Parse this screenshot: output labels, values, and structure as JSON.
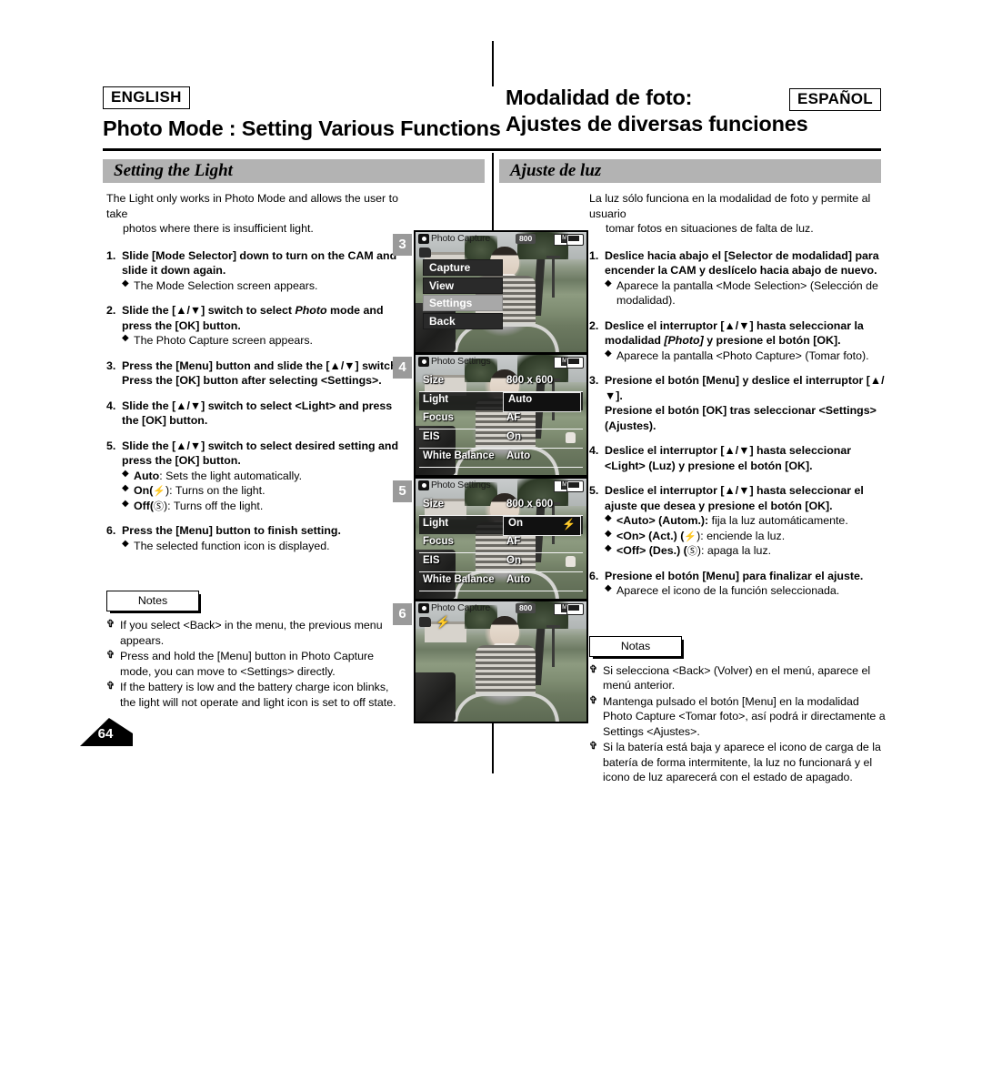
{
  "header": {
    "english_badge": "ENGLISH",
    "spanish_badge": "ESPAÑOL",
    "english_title": "Photo Mode : Setting Various Functions",
    "spanish_title_line1": "Modalidad de foto:",
    "spanish_title_line2": "Ajustes de diversas funciones"
  },
  "section": {
    "english_title": "Setting the Light",
    "spanish_title": "Ajuste de luz"
  },
  "english": {
    "intro_line1": "The Light only works in Photo Mode and allows the user to take",
    "intro_line2": "photos where there is insufficient light.",
    "steps": [
      {
        "num": "1.",
        "head": "Slide [Mode Selector] down to turn on the CAM and slide it down again.",
        "bullets": [
          "The Mode Selection screen appears."
        ]
      },
      {
        "num": "2.",
        "head_a": "Slide the [▲/▼] switch to select ",
        "head_em": "Photo",
        "head_b": " mode and press the [OK] button.",
        "bullets": [
          "The Photo Capture screen appears."
        ]
      },
      {
        "num": "3.",
        "head": "Press the [Menu] button and slide the [▲/▼] switch.",
        "head2": "Press the [OK] button after selecting <Settings>.",
        "bullets": []
      },
      {
        "num": "4.",
        "head": "Slide the [▲/▼] switch to select <Light> and press the [OK] button.",
        "bullets": []
      },
      {
        "num": "5.",
        "head": "Slide the [▲/▼] switch to select desired setting and press the [OK] button.",
        "bullets": [
          {
            "bold": "Auto",
            "rest": ": Sets the light automatically."
          },
          {
            "bold": "On(",
            "icon": "flash",
            "rest": "): Turns on the light."
          },
          {
            "bold": "Off(",
            "icon": "nolight",
            "rest": "): Turns off the light."
          }
        ]
      },
      {
        "num": "6.",
        "head": "Press the [Menu] button to finish setting.",
        "bullets": [
          "The selected function icon is displayed."
        ]
      }
    ],
    "notes_label": "Notes",
    "notes": [
      "If you select <Back> in the menu, the previous menu appears.",
      "Press and hold the [Menu] button in Photo Capture mode, you can move to <Settings> directly.",
      "If the battery is low and the battery charge icon blinks, the light will not operate and light icon is set to off state."
    ]
  },
  "spanish": {
    "intro_line1": "La luz sólo funciona en la modalidad de foto y permite al usuario",
    "intro_line2": "tomar fotos en situaciones de falta de luz.",
    "steps": [
      {
        "num": "1.",
        "head": "Deslice hacia abajo el [Selector de modalidad] para encender la CAM y deslícelo hacia abajo de nuevo.",
        "bullets": [
          "Aparece la pantalla <Mode Selection> (Selección de modalidad)."
        ]
      },
      {
        "num": "2.",
        "head_a": "Deslice el interruptor [▲/▼] hasta seleccionar la modalidad ",
        "head_em": "[Photo]",
        "head_b": " y presione el botón [OK].",
        "bullets": [
          "Aparece la pantalla <Photo Capture> (Tomar foto)."
        ]
      },
      {
        "num": "3.",
        "head": "Presione el botón [Menu] y deslice el interruptor [▲/▼].",
        "head2": "Presione el botón [OK] tras seleccionar <Settings> (Ajustes).",
        "bullets": []
      },
      {
        "num": "4.",
        "head": "Deslice el interruptor [▲/▼] hasta seleccionar <Light> (Luz) y presione el botón [OK].",
        "bullets": []
      },
      {
        "num": "5.",
        "head": "Deslice el interruptor [▲/▼] hasta seleccionar el ajuste que desea y presione el botón [OK].",
        "bullets": [
          {
            "bold": "<Auto> (Autom.):",
            "rest": " fija la luz automáticamente."
          },
          {
            "bold": "<On> (Act.) (",
            "icon": "flash",
            "rest": "): enciende la luz."
          },
          {
            "bold": "<Off> (Des.) (",
            "icon": "nolight",
            "rest": "): apaga la luz."
          }
        ]
      },
      {
        "num": "6.",
        "head": "Presione el botón [Menu] para finalizar el ajuste.",
        "bullets": [
          "Aparece el icono de la función seleccionada."
        ]
      }
    ],
    "notes_label": "Notas",
    "notes": [
      "Si selecciona <Back> (Volver) en el menú, aparece el menú anterior.",
      "Mantenga pulsado el botón [Menu] en la modalidad Photo Capture <Tomar foto>, así podrá ir directamente a Settings <Ajustes>.",
      "Si la batería está baja y aparece el icono de carga de la batería de forma intermitente, la luz no funcionará y el icono de luz aparecerá con el estado de apagado."
    ]
  },
  "screens": [
    {
      "badge": "3",
      "title": "Photo Capture",
      "counter": "800",
      "menu_items": [
        {
          "label": "Capture",
          "selected": false
        },
        {
          "label": "View",
          "selected": false
        },
        {
          "label": "Settings",
          "selected": true
        },
        {
          "label": "Back",
          "selected": false
        }
      ]
    },
    {
      "badge": "4",
      "title": "Photo Settings",
      "counter": "",
      "rows": [
        {
          "key": "Size",
          "value": "800 x 600",
          "selected": false
        },
        {
          "key": "Light",
          "value": "Auto",
          "selected": true
        },
        {
          "key": "Focus",
          "value": "AF",
          "selected": false
        },
        {
          "key": "EIS",
          "value": "On",
          "selected": false,
          "icon": "hand"
        },
        {
          "key": "White Balance",
          "value": "Auto",
          "selected": false
        }
      ]
    },
    {
      "badge": "5",
      "title": "Photo Settings",
      "counter": "",
      "rows": [
        {
          "key": "Size",
          "value": "800 x 600",
          "selected": false
        },
        {
          "key": "Light",
          "value": "On",
          "selected": true,
          "icon": "flash"
        },
        {
          "key": "Focus",
          "value": "AF",
          "selected": false
        },
        {
          "key": "EIS",
          "value": "On",
          "selected": false,
          "icon": "hand"
        },
        {
          "key": "White Balance",
          "value": "Auto",
          "selected": false
        }
      ]
    },
    {
      "badge": "6",
      "title": "Photo Capture",
      "counter": "800",
      "overlay_icons": [
        "rec",
        "flash"
      ]
    }
  ],
  "page_number": "64"
}
